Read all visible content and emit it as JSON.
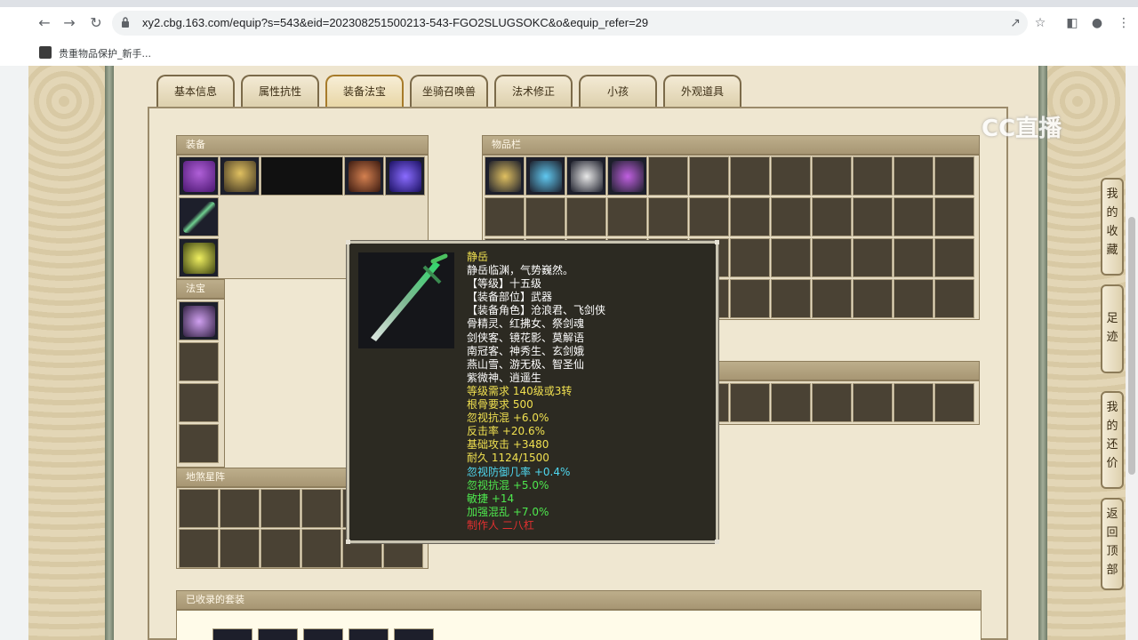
{
  "browser": {
    "url": "xy2.cbg.163.com/equip?s=543&eid=202308251500213-543-FGO2SLUGSOKC&o&equip_refer=29",
    "bookmark_label": "贵重物品保护_新手..."
  },
  "tabs": [
    {
      "label": "基本信息"
    },
    {
      "label": "属性抗性"
    },
    {
      "label": "装备法宝"
    },
    {
      "label": "坐骑召唤兽"
    },
    {
      "label": "法术修正"
    },
    {
      "label": "小孩"
    },
    {
      "label": "外观道具"
    }
  ],
  "active_tab": "装备法宝",
  "sections": {
    "equipment": "装备",
    "fabao": "法宝",
    "dishaxing": "地煞星阵",
    "inventory": "物品栏",
    "collected_sets": "已收录的套装"
  },
  "tooltip": {
    "lines": [
      {
        "text": "静岳",
        "color": "#f0e050"
      },
      {
        "text": "静岳临渊，气势巍然。",
        "color": "#ffffff"
      },
      {
        "text": "【等级】十五级",
        "color": "#ffffff"
      },
      {
        "text": "【装备部位】武器",
        "color": "#ffffff"
      },
      {
        "text": "【装备角色】沧浪君、飞剑侠",
        "color": "#ffffff"
      },
      {
        "text": "骨精灵、红拂女、祭剑魂",
        "color": "#ffffff"
      },
      {
        "text": "剑侠客、镜花影、莫解语",
        "color": "#ffffff"
      },
      {
        "text": "南冠客、神秀生、玄剑娥",
        "color": "#ffffff"
      },
      {
        "text": "燕山雪、游无极、智圣仙",
        "color": "#ffffff"
      },
      {
        "text": "紫微神、逍遥生",
        "color": "#ffffff"
      },
      {
        "text": "等级需求 140级或3转",
        "color": "#f0e050"
      },
      {
        "text": "根骨要求 500",
        "color": "#f0e050"
      },
      {
        "text": "忽视抗混 +6.0%",
        "color": "#f0e050"
      },
      {
        "text": "反击率 +20.6%",
        "color": "#f0e050"
      },
      {
        "text": "基础攻击 +3480",
        "color": "#f0e050"
      },
      {
        "text": "耐久 1124/1500",
        "color": "#f0e050"
      },
      {
        "text": "忽视防御几率 +0.4%",
        "color": "#4fd8f0"
      },
      {
        "text": "忽视抗混 +5.0%",
        "color": "#4ee84e"
      },
      {
        "text": "敏捷 +14",
        "color": "#4ee84e"
      },
      {
        "text": "加强混乱 +7.0%",
        "color": "#4ee84e"
      },
      {
        "text": "制作人 二八杠",
        "color": "#e03030"
      }
    ]
  },
  "side_buttons": [
    {
      "label": "我的收藏"
    },
    {
      "label": "足迹"
    },
    {
      "label": "我的还价"
    },
    {
      "label": "返回顶部"
    }
  ],
  "watermark": "CC直播",
  "colors": {
    "page_bg": "#e9dfc7",
    "slot_bg": "#4a4234",
    "tooltip_bg": "#2c2a22",
    "name_yellow": "#f0e050",
    "maker_red": "#e03030"
  }
}
